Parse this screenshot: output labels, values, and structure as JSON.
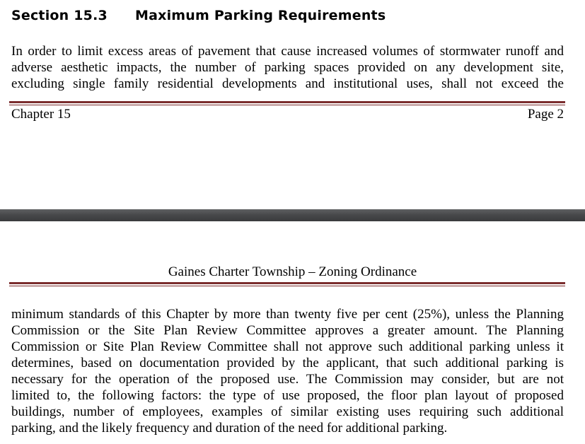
{
  "section": {
    "number": "Section 15.3",
    "title": "Maximum Parking Requirements"
  },
  "page_top": {
    "paragraph_lines": [
      "In order to limit excess areas of pavement that cause increased volumes of stormwater runoff and",
      "adverse aesthetic impacts, the number of parking spaces provided on any development site,",
      "excluding single family residential developments and institutional uses, shall not exceed the"
    ],
    "footer": {
      "chapter": "Chapter 15",
      "page": "Page 2"
    }
  },
  "page_bottom": {
    "header": "Gaines Charter Township – Zoning Ordinance",
    "paragraph_lines": [
      "minimum standards of this Chapter by more than twenty five per cent (25%), unless the Planning",
      "Commission or the Site Plan Review Committee approves a greater amount.  The Planning",
      "Commission or Site Plan Review Committee shall not approve such additional parking unless it",
      "determines, based on documentation provided by the applicant, that such additional parking is",
      "necessary for the operation of the proposed use.  The Commission may consider, but are not",
      "limited to, the following factors:  the type of use proposed, the floor plan layout of proposed",
      "buildings, number of employees, examples of similar existing uses requiring such additional",
      "parking, and the likely frequency and duration of the need for additional parking."
    ]
  },
  "colors": {
    "rule": "#7b2d2e",
    "page_gap": "#48494b"
  }
}
